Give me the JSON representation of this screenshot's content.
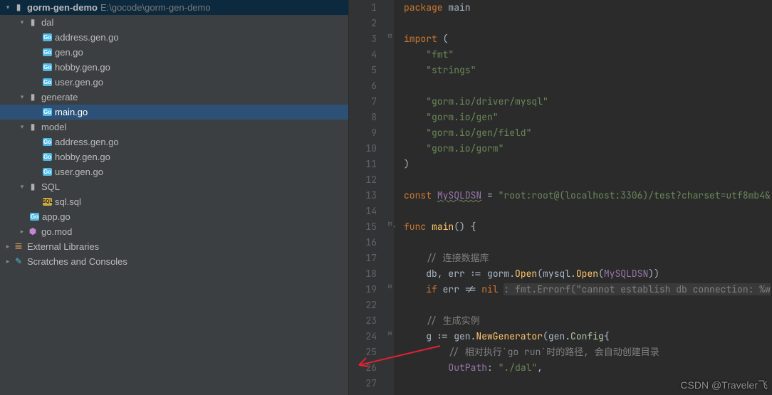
{
  "tree": {
    "project_name": "gorm-gen-demo",
    "project_path": "E:\\gocode\\gorm-gen-demo",
    "dal": {
      "label": "dal",
      "items": [
        "address.gen.go",
        "gen.go",
        "hobby.gen.go",
        "user.gen.go"
      ]
    },
    "generate": {
      "label": "generate",
      "items": [
        "main.go"
      ]
    },
    "model": {
      "label": "model",
      "items": [
        "address.gen.go",
        "hobby.gen.go",
        "user.gen.go"
      ]
    },
    "sql": {
      "label": "SQL",
      "items": [
        "sql.sql"
      ]
    },
    "root_files": {
      "app": "app.go",
      "gomod": "go.mod"
    },
    "external": "External Libraries",
    "scratches": "Scratches and Consoles"
  },
  "code": {
    "lines": [
      {
        "n": "1",
        "k": "pkg",
        "t": "package ",
        "t2": "main"
      },
      {
        "n": "2",
        "t": ""
      },
      {
        "n": "3",
        "k": "imp",
        "t": "import ("
      },
      {
        "n": "4",
        "k": "str",
        "t": "    \"fmt\""
      },
      {
        "n": "5",
        "k": "str",
        "t": "    \"strings\""
      },
      {
        "n": "6",
        "t": ""
      },
      {
        "n": "7",
        "k": "str",
        "t": "    \"gorm.io/driver/mysql\""
      },
      {
        "n": "8",
        "k": "str",
        "t": "    \"gorm.io/gen\""
      },
      {
        "n": "9",
        "k": "str",
        "t": "    \"gorm.io/gen/field\""
      },
      {
        "n": "10",
        "k": "str",
        "t": "    \"gorm.io/gorm\""
      },
      {
        "n": "11",
        "t": ")"
      },
      {
        "n": "12",
        "t": ""
      },
      {
        "n": "13",
        "k": "const",
        "t": "const ",
        "id": "MySQLDSN",
        "rest": " = ",
        "s": "\"root:root@(localhost:3306)/test?charset=utf8mb4&"
      },
      {
        "n": "14",
        "t": ""
      },
      {
        "n": "15",
        "k": "func",
        "t": "func ",
        "fn": "main",
        "rest": "() {"
      },
      {
        "n": "16",
        "t": ""
      },
      {
        "n": "17",
        "k": "com",
        "t": "    // 连接数据库"
      },
      {
        "n": "18",
        "k": "open",
        "a": "    db",
        "b": ", ",
        "c": "err",
        "d": " := gorm.",
        "e": "Open",
        "f": "(mysql.",
        "g": "Open",
        "h": "(",
        "i": "MySQLDSN",
        "j": "))"
      },
      {
        "n": "19",
        "k": "if",
        "a": "    if ",
        "b": "err != ",
        "c": "nil ",
        "d": ": fmt.Errorf(\"cannot establish db connection: %w"
      },
      {
        "n": "22",
        "t": ""
      },
      {
        "n": "23",
        "k": "com",
        "t": "    // 生成实例"
      },
      {
        "n": "24",
        "k": "gen",
        "a": "    g := gen.",
        "b": "NewGenerator",
        "c": "(gen.",
        "d": "Config",
        "e": "{"
      },
      {
        "n": "25",
        "k": "com",
        "t": "        // 相对执行`go run`时的路径, 会自动创建目录"
      },
      {
        "n": "26",
        "k": "out",
        "a": "        ",
        "b": "OutPath",
        "c": ": ",
        "d": "\"./dal\"",
        "e": ","
      },
      {
        "n": "27",
        "t": ""
      }
    ]
  },
  "watermark": "CSDN @Traveler飞"
}
